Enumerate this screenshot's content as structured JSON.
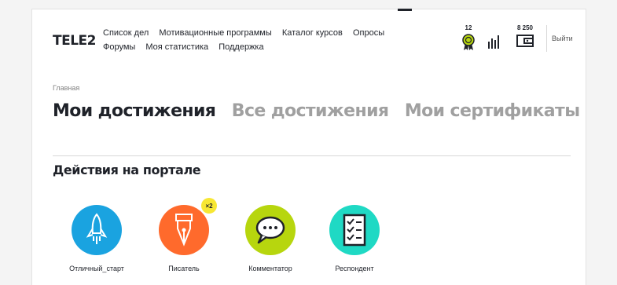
{
  "logo": "TELE2",
  "nav": {
    "row1": [
      "Список дел",
      "Мотивационные программы",
      "Каталог курсов",
      "Опросы"
    ],
    "row2": [
      "Форумы",
      "Моя статистика",
      "Поддержка"
    ]
  },
  "stats": {
    "medal": {
      "count": "12",
      "icon": "medal-icon"
    },
    "chart": {
      "count": "",
      "icon": "bar-chart-icon"
    },
    "wallet": {
      "count": "8 250",
      "icon": "wallet-icon"
    }
  },
  "logout_label": "Выйти",
  "breadcrumb": "Главная",
  "tabs": [
    {
      "label": "Мои достижения",
      "active": true
    },
    {
      "label": "Все достижения",
      "active": false
    },
    {
      "label": "Мои сертификаты",
      "active": false
    }
  ],
  "section_title": "Действия на портале",
  "badges": [
    {
      "label": "Отличный_старт",
      "color": "#1aa3e0",
      "icon": "rocket-icon",
      "multiplier": ""
    },
    {
      "label": "Писатель",
      "color": "#ff6a2c",
      "icon": "pen-nib-icon",
      "multiplier": "×2"
    },
    {
      "label": "Комментатор",
      "color": "#b7d60e",
      "icon": "speech-bubble-icon",
      "multiplier": ""
    },
    {
      "label": "Респондент",
      "color": "#1fd9c4",
      "icon": "checklist-icon",
      "multiplier": ""
    }
  ],
  "colors": {
    "accent_yellow": "#f7e733",
    "text_dark": "#1f2229",
    "inactive_tab": "#a0a0a0"
  }
}
